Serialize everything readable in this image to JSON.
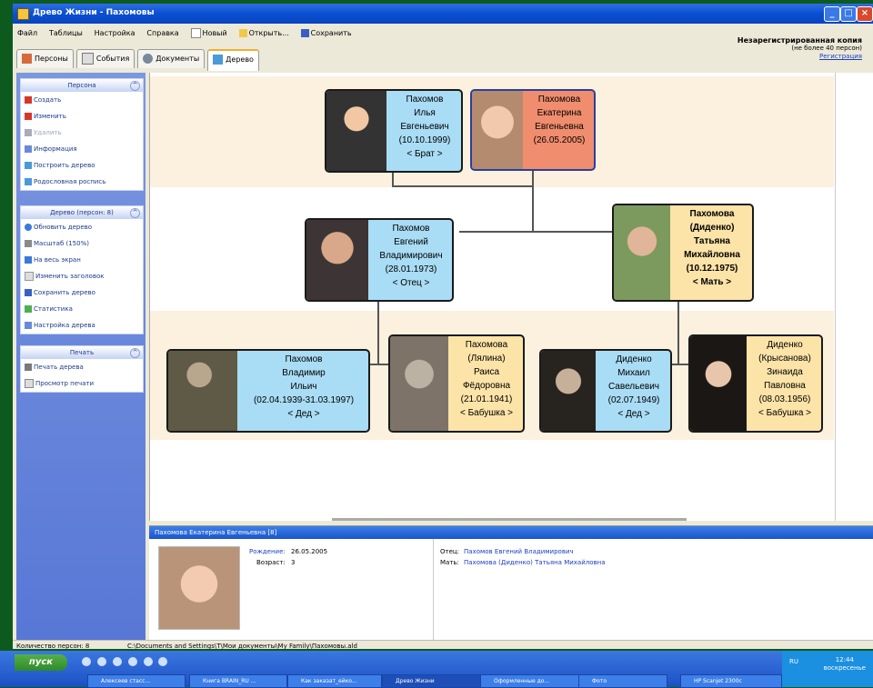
{
  "window": {
    "title": "Древо Жизни - Пахомовы"
  },
  "menu": {
    "file": "Файл",
    "tables": "Таблицы",
    "settings": "Настройка",
    "help": "Справка",
    "new": "Новый",
    "open": "Открыть...",
    "save": "Сохранить"
  },
  "registration": {
    "line1": "Незарегистрированная копия",
    "line2": "(не более 40 персон)",
    "link": "Регистрация"
  },
  "tabs": [
    "Персоны",
    "События",
    "Документы",
    "Дерево"
  ],
  "sidebar": {
    "persons": {
      "title": "Персона",
      "items": [
        "Создать",
        "Изменить",
        "Удалить",
        "Информация",
        "Построить дерево",
        "Родословная роспись"
      ]
    },
    "tree": {
      "title": "Дерево (персон: 8)",
      "items": [
        "Обновить дерево",
        "Масштаб (150%)",
        "На весь экран",
        "Изменить заголовок",
        "Сохранить дерево",
        "Статистика",
        "Настройка дерева"
      ]
    },
    "print": {
      "title": "Печать",
      "items": [
        "Печать дерева",
        "Просмотр печати"
      ]
    }
  },
  "tree": {
    "brother": {
      "lines": [
        "Пахомов",
        "Илья",
        "Евгеньевич",
        "(10.10.1999)",
        "< Брат >"
      ]
    },
    "self": {
      "lines": [
        "Пахомова",
        "Екатерина",
        "Евгеньевна",
        "(26.05.2005)"
      ]
    },
    "father": {
      "lines": [
        "Пахомов",
        "Евгений",
        "Владимирович",
        "(28.01.1973)",
        "< Отец >"
      ]
    },
    "mother": {
      "lines": [
        "Пахомова",
        "(Диденко)",
        "Татьяна",
        "Михайловна",
        "(10.12.1975)",
        "< Мать >"
      ]
    },
    "pgf": {
      "lines": [
        "Пахомов",
        "Владимир",
        "Ильич",
        "(02.04.1939-31.03.1997)",
        "< Дед >"
      ]
    },
    "pgm": {
      "lines": [
        "Пахомова",
        "(Лялина)",
        "Раиса",
        "Фёдоровна",
        "(21.01.1941)",
        "< Бабушка >"
      ]
    },
    "mgf": {
      "lines": [
        "Диденко",
        "Михаил",
        "Савельевич",
        "(02.07.1949)",
        "< Дед >"
      ]
    },
    "mgm": {
      "lines": [
        "Диденко",
        "(Крысанова)",
        "Зинаида",
        "Павловна",
        "(08.03.1956)",
        "< Бабушка >"
      ]
    }
  },
  "details": {
    "header": "Пахомова Екатерина Евгеньевна [8]",
    "born_label": "Рождение:",
    "born_value": "26.05.2005",
    "age_label": "Возраст:",
    "age_value": "3",
    "father_label": "Отец:",
    "father_value": "Пахомов Евгений Владимирович",
    "mother_label": "Мать:",
    "mother_value": "Пахомова (Диденко) Татьяна Михайловна"
  },
  "status": {
    "count": "Количество персон: 8",
    "path": "C:\\Documents and Settings\\Т\\Мои документы\\My Family\\Пахомовы.ald"
  },
  "taskbar": {
    "start": "пуск",
    "tasks": [
      "Алексеев стасс...",
      "Книга BRAIN_RU ...",
      "Как заказат_ейко...",
      "Древо Жизни",
      "Оформленные до...",
      "Фото",
      "НР Scanjet 2300c"
    ],
    "time": "12:44",
    "day": "воскресенье",
    "lang": "RU"
  }
}
